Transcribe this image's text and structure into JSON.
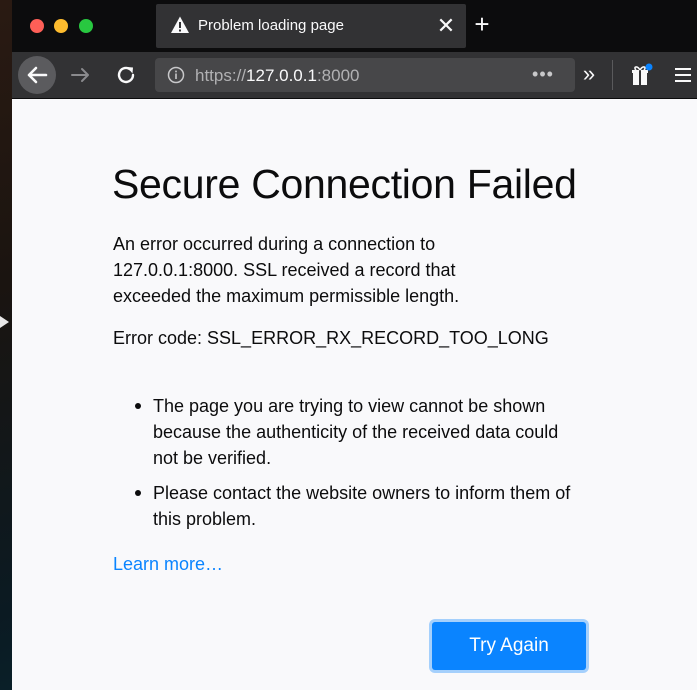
{
  "tab": {
    "title": "Problem loading page",
    "close_glyph": "✕",
    "new_tab_glyph": "+",
    "icon": "warning-icon"
  },
  "navbar": {
    "url_prefix": "https://",
    "url_host": "127.0.0.1",
    "url_suffix": ":8000",
    "page_actions_glyph": "•••",
    "overflow_glyph": "»",
    "icons": [
      "back-icon",
      "forward-icon",
      "reload-icon",
      "info-icon",
      "extension-icon",
      "menu-icon"
    ]
  },
  "error_page": {
    "title": "Secure Connection Failed",
    "description": "An error occurred during a connection to 127.0.0.1:8000. SSL received a record that exceeded the maximum permissible length.",
    "error_code": "Error code: SSL_ERROR_RX_RECORD_TOO_LONG",
    "reasons": [
      "The page you are trying to view cannot be shown because the authenticity of the received data could not be verified.",
      "Please contact the website owners to inform them of this problem."
    ],
    "learn_more": "Learn more…",
    "try_again": "Try Again"
  },
  "colors": {
    "accent": "#0a84ff",
    "toolbar": "#323234",
    "tabstrip": "#0c0c0d",
    "page_bg": "#f9f9fb"
  }
}
